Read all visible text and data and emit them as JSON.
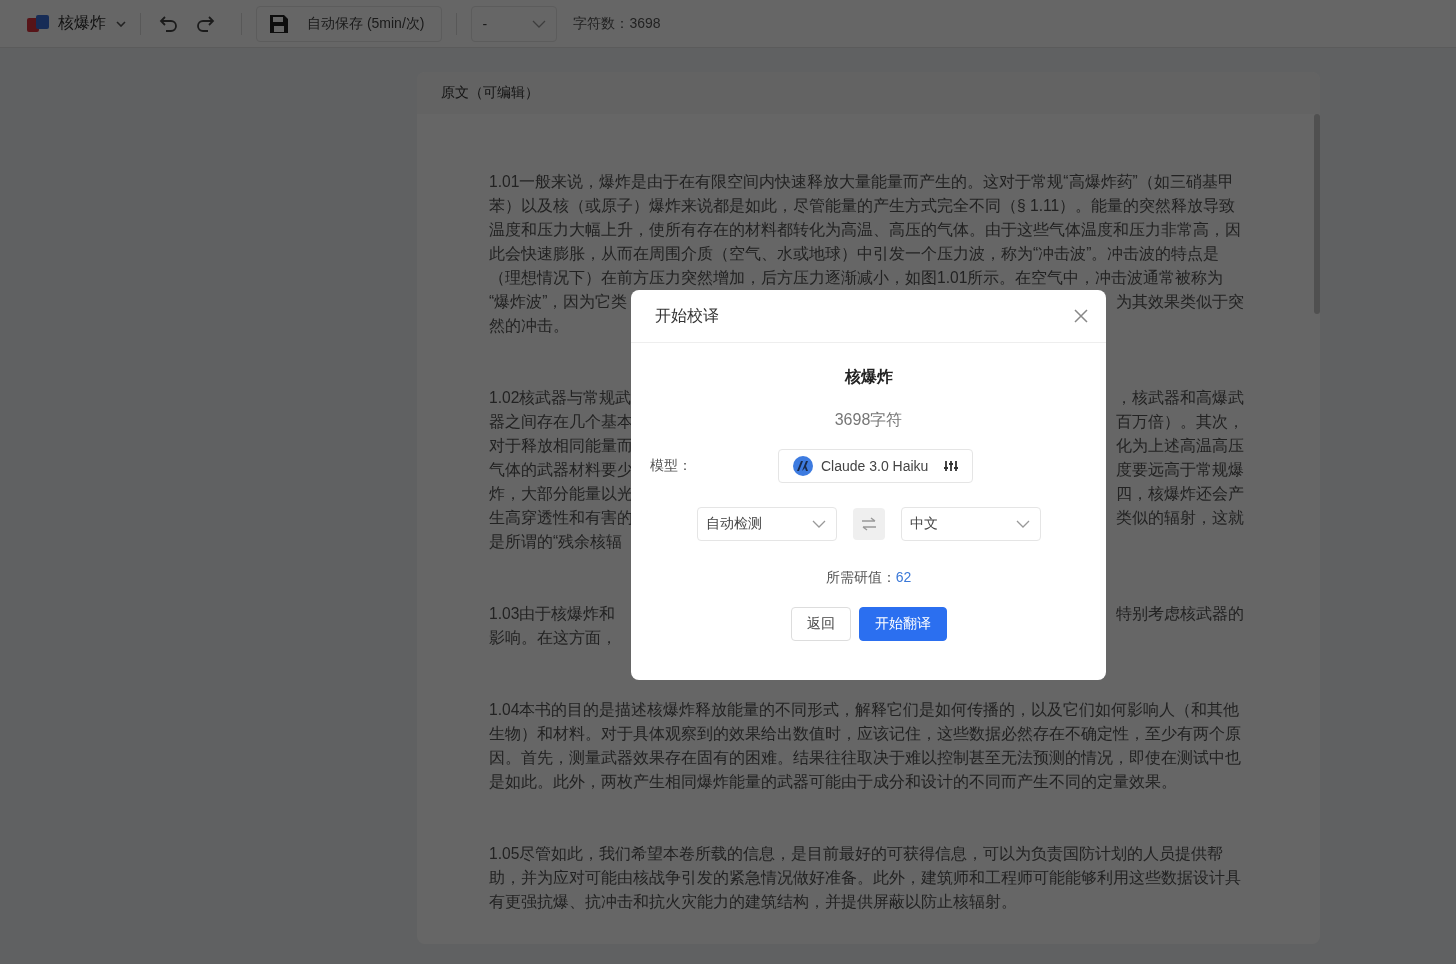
{
  "toolbar": {
    "doc_title": "核爆炸",
    "save_button": "自动保存 (5min/次)",
    "select_value": "-",
    "char_count": "字符数：3698"
  },
  "editor": {
    "header": "原文（可编辑）",
    "paragraphs": [
      {
        "lines": [
          {
            "kind": "full",
            "text": "1.01一般来说，爆炸是由于在有限空间内快速释放大量能量而产生的。这对于常规“高爆炸药”（如三硝基甲"
          },
          {
            "kind": "full",
            "text": "苯）以及核（或原子）爆炸来说都是如此，尽管能量的产生方式完全不同（§ 1.11）。能量的突然释放导致"
          },
          {
            "kind": "full",
            "text": "温度和压力大幅上升，使所有存在的材料都转化为高温、高压的气体。由于这些气体温度和压力非常高，因"
          },
          {
            "kind": "full",
            "text": "此会快速膨胀，从而在周围介质（空气、水或地球）中引发一个压力波，称为“冲击波”。冲击波的特点是"
          },
          {
            "kind": "full",
            "text": "（理想情况下）在前方压力突然增加，后方压力逐渐减小，如图1.01所示。在空气中，冲击波通常被称为"
          },
          {
            "kind": "split",
            "left": "“爆炸波”，因为它类",
            "right": "为其效果类似于突"
          },
          {
            "kind": "full",
            "text": "然的冲击。"
          }
        ]
      },
      {
        "lines": [
          {
            "kind": "split",
            "left": "1.02核武器与常规武",
            "right": "，核武器和高爆武"
          },
          {
            "kind": "split",
            "left": "器之间存在几个基本",
            "right": "百万倍）。其次，"
          },
          {
            "kind": "split",
            "left": "对于释放相同能量而",
            "right": "化为上述高温高压"
          },
          {
            "kind": "split",
            "left": "气体的武器材料要少",
            "right": "度要远高于常规爆"
          },
          {
            "kind": "split",
            "left": "炸，大部分能量以光",
            "right": "四，核爆炸还会产"
          },
          {
            "kind": "split",
            "left": "生高穿透性和有害的",
            "right": "类似的辐射，这就"
          },
          {
            "kind": "split",
            "left": "是所谓的“残余核辐"
          }
        ]
      },
      {
        "lines": [
          {
            "kind": "split",
            "left": "1.03由于核爆炸和",
            "right": "特别考虑核武器的"
          },
          {
            "kind": "split",
            "left": "影响。在这方面，"
          }
        ]
      },
      {
        "lines": [
          {
            "kind": "full",
            "text": "1.04本书的目的是描述核爆炸释放能量的不同形式，解释它们是如何传播的，以及它们如何影响人（和其他"
          },
          {
            "kind": "full",
            "text": "生物）和材料。对于具体观察到的效果给出数值时，应该记住，这些数据必然存在不确定性，至少有两个原"
          },
          {
            "kind": "full",
            "text": "因。首先，测量武器效果存在固有的困难。结果往往取决于难以控制甚至无法预测的情况，即使在测试中也"
          },
          {
            "kind": "full",
            "text": "是如此。此外，两枚产生相同爆炸能量的武器可能由于成分和设计的不同而产生不同的定量效果。"
          }
        ]
      },
      {
        "lines": [
          {
            "kind": "full",
            "text": "1.05尽管如此，我们希望本卷所载的信息，是目前最好的可获得信息，可以为负责国防计划的人员提供帮"
          },
          {
            "kind": "full",
            "text": "助，并为应对可能由核战争引发的紧急情况做好准备。此外，建筑师和工程师可能能够利用这些数据设计具"
          },
          {
            "kind": "full",
            "text": "有更强抗爆、抗冲击和抗火灾能力的建筑结构，并提供屏蔽以防止核辐射。"
          }
        ]
      }
    ]
  },
  "dialog": {
    "title": "开始校译",
    "doc_name": "核爆炸",
    "char_info": "3698字符",
    "model_label": "模型：",
    "model": "Claude 3.0 Haiku",
    "source_lang": "自动检测",
    "target_lang": "中文",
    "cost_label": "所需研值：",
    "cost": "62",
    "buttons": [
      {
        "label": "返回",
        "kind": "secondary"
      },
      {
        "label": "开始翻译",
        "kind": "primary"
      }
    ]
  }
}
